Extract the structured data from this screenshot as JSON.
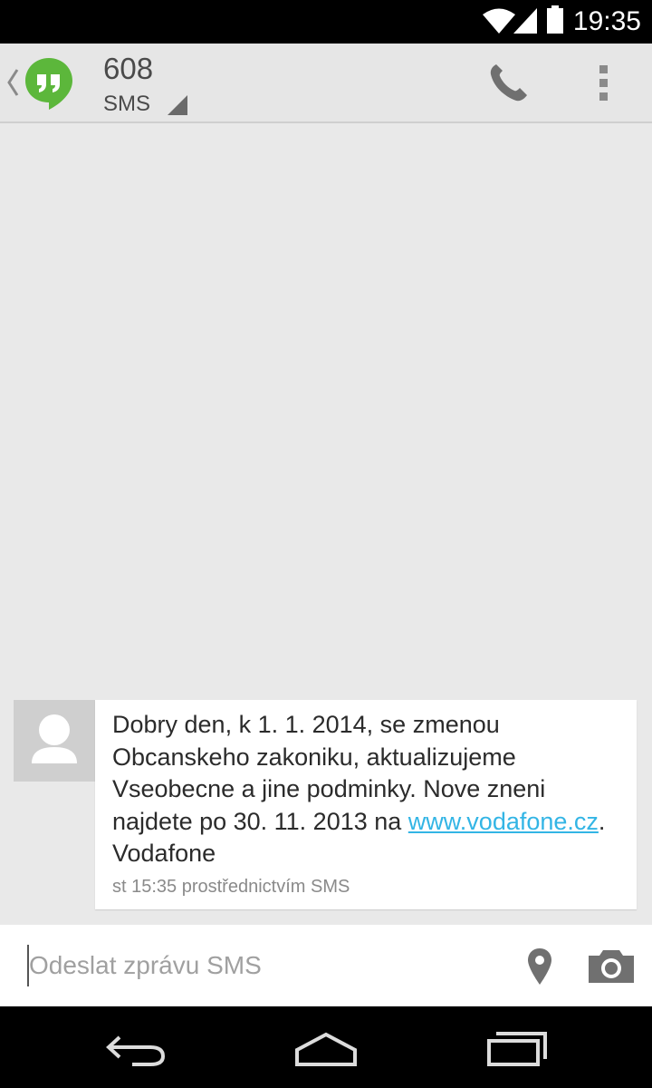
{
  "status_bar": {
    "time": "19:35",
    "icons": [
      "wifi-icon",
      "signal-icon",
      "battery-icon"
    ]
  },
  "app_bar": {
    "contact_name": "608",
    "channel": "SMS",
    "icons": [
      "back-chevron-icon",
      "hangouts-logo-icon",
      "phone-icon",
      "overflow-menu-icon"
    ]
  },
  "conversation": {
    "messages": [
      {
        "text_before_link": "Dobry den, k 1. 1. 2014, se zmenou Obcanskeho zakoniku, aktualizujeme Vseobecne a jine podminky. Nove zneni najdete po 30. 11. 2013 na ",
        "link": "www.vodafone.cz",
        "text_after_link": ". Vodafone",
        "meta": "st 15:35 prostřednictvím SMS",
        "avatar_icon": "person-avatar-icon"
      }
    ]
  },
  "compose": {
    "placeholder": "Odeslat zprávu SMS",
    "value": "",
    "icons": [
      "location-pin-icon",
      "camera-icon"
    ]
  },
  "nav_bar": {
    "icons": [
      "back-icon",
      "home-icon",
      "recents-icon"
    ]
  },
  "colors": {
    "background": "#e9e9e9",
    "link": "#33b5e5",
    "hangouts_green": "#5cb73b",
    "icon_gray": "#707070"
  }
}
